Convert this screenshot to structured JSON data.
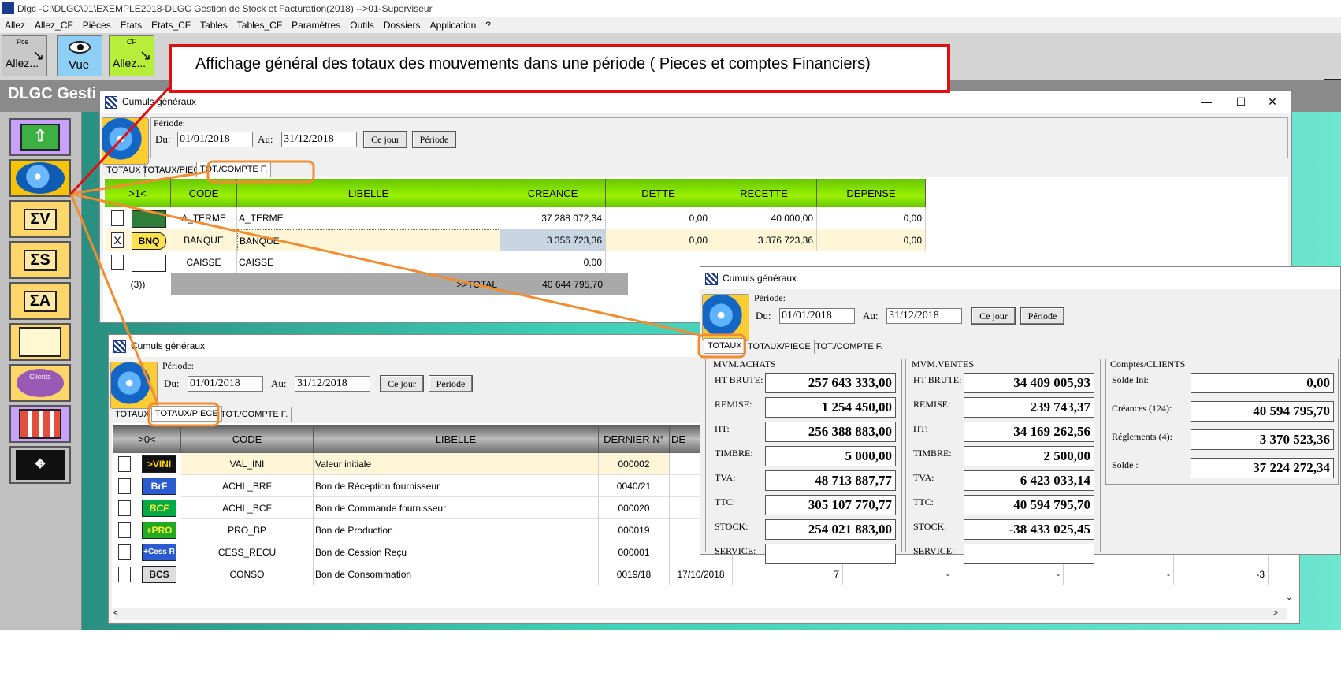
{
  "app": {
    "title": "Dlgc -C:\\DLGC\\01\\EXEMPLE2018-DLGC Gestion de Stock et Facturation(2018) -->01-Superviseur",
    "band_title": "DLGC Gesti",
    "menu": [
      "Allez",
      "Allez_CF",
      "Pièces",
      "Etats",
      "Etats_CF",
      "Tables",
      "Tables_CF",
      "Paramètres",
      "Outils",
      "Dossiers",
      "Application",
      "?"
    ],
    "toolbar": [
      {
        "top": "Pce",
        "label": "Allez..."
      },
      {
        "top": "",
        "label": "Vue"
      },
      {
        "top": "CF",
        "label": "Allez..."
      }
    ],
    "left_buttons": [
      "up-arrow",
      "globe-logo",
      "ΣV",
      "ΣS",
      "ΣA",
      "fournisseurs",
      "Clients",
      "grid-table",
      "move"
    ],
    "left_clients_label": "Clients"
  },
  "callout": "Affichage général des totaux des mouvements dans une période ( Pieces et comptes Financiers)",
  "win1": {
    "title": "Cumuls généraux",
    "periode_label": "Période:",
    "du_label": "Du:",
    "au_label": "Au:",
    "du": "01/01/2018",
    "au": "31/12/2018",
    "btn_cejour": "Ce jour",
    "btn_periode": "Période",
    "tabs": [
      "TOTAUX",
      "TOTAUX/PIECE",
      "TOT./COMPTE F."
    ],
    "headers": [
      ">1<",
      "CODE",
      "LIBELLE",
      "CREANCE",
      "DETTE",
      "RECETTE",
      "DEPENSE"
    ],
    "rows": [
      {
        "check": "",
        "icon": "icon-aterme",
        "code": "A_TERME",
        "libelle": "A_TERME",
        "creance": "37 288 072,34",
        "dette": "0,00",
        "recette": "40 000,00",
        "depense": "0,00"
      },
      {
        "check": "X",
        "icon": "BNQ",
        "code": "BANQUE",
        "libelle": "BANQUE",
        "creance": "3 356 723,36",
        "dette": "0,00",
        "recette": "3 376 723,36",
        "depense": "0,00"
      },
      {
        "check": "",
        "icon": "icon-caisse",
        "code": "CAISSE",
        "libelle": "CAISSE",
        "creance": "0,00",
        "dette": "",
        "recette": "",
        "depense": ""
      }
    ],
    "footer_count": "(3))",
    "footer_label": ">>TOTAL",
    "footer_creance": "40 644 795,70"
  },
  "win2": {
    "title": "Cumuls généraux",
    "periode_label": "Période:",
    "du_label": "Du:",
    "au_label": "Au:",
    "du": "01/01/2018",
    "au": "31/12/2018",
    "btn_cejour": "Ce jour",
    "btn_periode": "Période",
    "tabs": [
      "TOTAUX",
      "TOTAUX/PIECE",
      "TOT./COMPTE F."
    ],
    "headers": [
      ">0<",
      "CODE",
      "LIBELLE",
      "DERNIER N°",
      "DE"
    ],
    "rows": [
      {
        "icon": ">VINI",
        "code": "VAL_INI",
        "libelle": "Valeur initiale",
        "dernier": "000002",
        "date": "",
        "c1": "",
        "c2": "",
        "c3": "",
        "c4": "",
        "c5": "",
        "c6": ""
      },
      {
        "icon": "BrF",
        "code": "ACHL_BRF",
        "libelle": "Bon de Réception fournisseur",
        "dernier": "0040/21",
        "date": "",
        "c1": "",
        "c2": "",
        "c3": "",
        "c4": "",
        "c5": "",
        "c6": ""
      },
      {
        "icon": "BCF",
        "code": "ACHL_BCF",
        "libelle": "Bon de Commande fournisseur",
        "dernier": "000020",
        "date": "",
        "c1": "",
        "c2": "",
        "c3": "",
        "c4": "",
        "c5": "",
        "c6": ""
      },
      {
        "icon": "+PRO",
        "code": "PRO_BP",
        "libelle": "Bon de Production",
        "dernier": "000019",
        "date": "",
        "c1": "",
        "c2": "",
        "c3": "",
        "c4": "",
        "c5": "",
        "c6": ""
      },
      {
        "icon": "+Cess R",
        "code": "CESS_RECU",
        "libelle": "Bon de Cession Reçu",
        "dernier": "000001",
        "date": "",
        "c1": "",
        "c2": "",
        "c3": "",
        "c4": "",
        "c5": "",
        "c6": ""
      },
      {
        "icon": "BCS",
        "code": "CONSO",
        "libelle": "Bon de Consommation",
        "dernier": "0019/18",
        "date": "17/10/2018",
        "c1": "7",
        "c2": "-",
        "c3": "-",
        "c4": "-",
        "c5": "-3",
        "c6": ""
      }
    ]
  },
  "win3": {
    "title": "Cumuls généraux",
    "periode_label": "Période:",
    "du_label": "Du:",
    "au_label": "Au:",
    "du": "01/01/2018",
    "au": "31/12/2018",
    "btn_cejour": "Ce jour",
    "btn_periode": "Période",
    "tabs": [
      "TOTAUX",
      "TOTAUX/PIECE",
      "TOT./COMPTE F."
    ],
    "achats": {
      "title": "MVM.ACHATS",
      "rows": [
        {
          "label": "HT BRUTE:",
          "value": "257 643 333,00"
        },
        {
          "label": "REMISE:",
          "value": "1 254 450,00"
        },
        {
          "label": "HT:",
          "value": "256 388 883,00"
        },
        {
          "label": "TIMBRE:",
          "value": "5 000,00"
        },
        {
          "label": "TVA:",
          "value": "48 713 887,77"
        },
        {
          "label": "TTC:",
          "value": "305 107 770,77"
        },
        {
          "label": "STOCK:",
          "value": "254 021 883,00"
        },
        {
          "label": "SERVICE:",
          "value": ""
        }
      ]
    },
    "ventes": {
      "title": "MVM.VENTES",
      "rows": [
        {
          "label": "HT BRUTE:",
          "value": "34 409 005,93"
        },
        {
          "label": "REMISE:",
          "value": "239 743,37"
        },
        {
          "label": "HT:",
          "value": "34 169 262,56"
        },
        {
          "label": "TIMBRE:",
          "value": "2 500,00"
        },
        {
          "label": "TVA:",
          "value": "6 423 033,14"
        },
        {
          "label": "TTC:",
          "value": "40 594 795,70"
        },
        {
          "label": "STOCK:",
          "value": "-38 433 025,45"
        },
        {
          "label": "SERVICE:",
          "value": ""
        }
      ]
    },
    "clients": {
      "title": "Comptes/CLIENTS",
      "rows": [
        {
          "label": "Solde Ini:",
          "value": "0,00"
        },
        {
          "label": "Créances (124):",
          "value": "40 594 795,70"
        },
        {
          "label": "Réglements (4):",
          "value": "3 370 523,36"
        },
        {
          "label": "Solde :",
          "value": "37 224 272,34"
        }
      ]
    }
  },
  "colors": {
    "orange": "#f28c30",
    "red": "#d11",
    "green_header": "#7be000"
  }
}
